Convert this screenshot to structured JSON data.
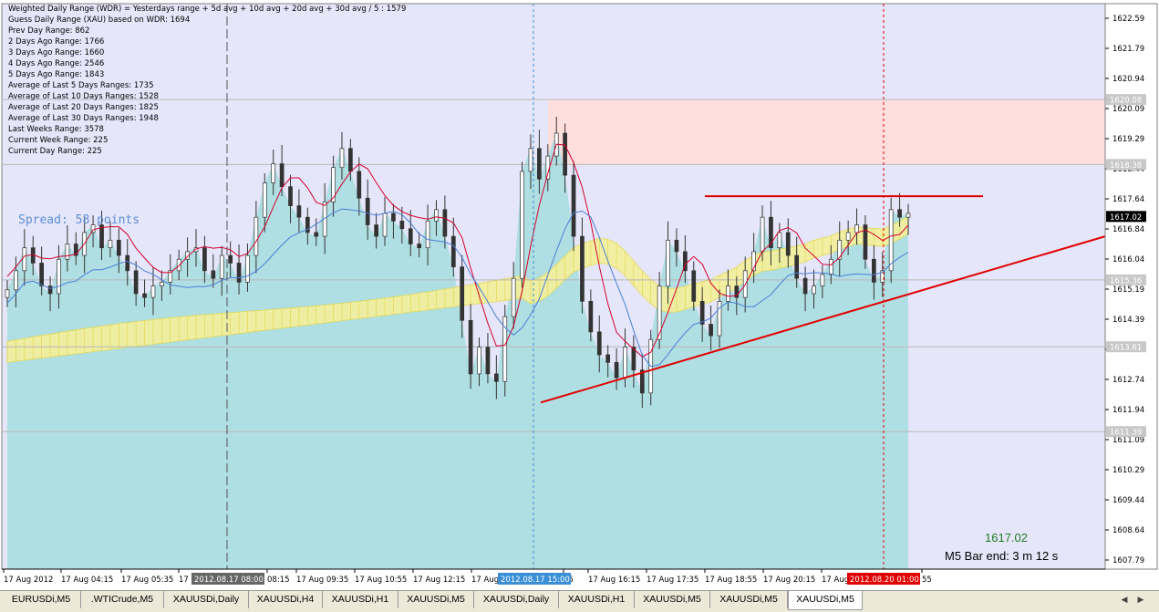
{
  "window": {
    "accent_bg": "#e6e6fa",
    "area_fill": "#b0dfe3"
  },
  "info_lines": [
    "Weighted Daily Range (WDR) = Yesterdays range + 5d avg + 10d avg + 20d avg + 30d avg / 5 : 1579",
    "Guess Daily Range (XAU) based on WDR: 1694",
    "Prev Day Range: 862",
    "2 Days Ago Range: 1766",
    "3 Days Ago Range: 1660",
    "4 Days Ago Range: 2546",
    "5 Days Ago Range: 1843",
    "Average of Last 5 Days Ranges: 1735",
    "Average of Last 10 Days Ranges: 1528",
    "Average of Last 20 Days Ranges: 1825",
    "Average of Last 30 Days Ranges: 1948",
    "Last Weeks Range: 3578",
    "Current Week Range: 225",
    "Current Day Range: 225"
  ],
  "spread_text": "Spread: 58 points",
  "current_price_text": "1617.02",
  "bar_end_text": "M5 Bar end: 3 m 12 s",
  "chart_data": {
    "type": "candlestick",
    "symbol": "XAUUSDi",
    "timeframe": "M5",
    "ylim": [
      1607.79,
      1622.59
    ],
    "y_ticks": [
      "1622.59",
      "1621.79",
      "1620.94",
      "1620.09",
      "1619.29",
      "1618.44",
      "1617.64",
      "1616.84",
      "1616.04",
      "1615.19",
      "1614.39",
      "1613.54",
      "1612.74",
      "1611.94",
      "1611.09",
      "1610.29",
      "1609.44",
      "1608.64",
      "1607.79"
    ],
    "x_tick_labels": [
      "17 Aug 2012",
      "17 Aug 04:15",
      "17 Aug 05:35",
      "17",
      "08:15",
      "17 Aug 09:35",
      "17 Aug 10:55",
      "17 Aug 12:15",
      "17 Aug",
      "55",
      "17 Aug 16:15",
      "17 Aug 17:35",
      "17 Aug 18:55",
      "17 Aug 20:15",
      "17 Aug",
      "55"
    ],
    "x_highlight_labels": [
      {
        "text": "2012.08.17 08:00",
        "color": "#666666"
      },
      {
        "text": "2012.08.17 15:00",
        "color": "#3a8fd6"
      },
      {
        "text": "2012.08.20 01:00",
        "color": "#e00000"
      }
    ],
    "price_level_labels": [
      {
        "price": 1620.08,
        "text": "1620.08"
      },
      {
        "price": 1618.38,
        "text": "1618.38"
      },
      {
        "price": 1617.02,
        "text": "1617.02",
        "current": true
      },
      {
        "price": 1615.36,
        "text": "1615.36"
      },
      {
        "price": 1613.61,
        "text": "1613.61"
      },
      {
        "price": 1611.39,
        "text": "1611.39"
      }
    ],
    "current_price": 1617.02,
    "zone": {
      "from_price": 1618.38,
      "to_price": 1620.08,
      "color": "#ffdede"
    },
    "resistance_line_price": 1617.55,
    "trendline": {
      "start_price": 1612.15,
      "end_price": 1616.5
    },
    "close_series": [
      1615.1,
      1615.6,
      1616.2,
      1615.8,
      1615.2,
      1615.0,
      1615.9,
      1616.3,
      1616.0,
      1616.6,
      1616.8,
      1616.2,
      1616.4,
      1616.0,
      1615.6,
      1615.0,
      1614.9,
      1615.2,
      1615.3,
      1615.6,
      1615.9,
      1616.1,
      1616.2,
      1615.6,
      1615.4,
      1616.0,
      1615.8,
      1615.3,
      1616.0,
      1617.0,
      1617.9,
      1618.4,
      1617.8,
      1617.3,
      1617.0,
      1616.6,
      1616.5,
      1617.4,
      1618.3,
      1618.8,
      1618.2,
      1617.5,
      1616.8,
      1616.5,
      1617.1,
      1616.9,
      1616.7,
      1616.3,
      1616.2,
      1616.9,
      1617.2,
      1616.5,
      1615.7,
      1614.3,
      1612.9,
      1613.6,
      1612.9,
      1612.7,
      1614.4,
      1615.4,
      1618.2,
      1618.8,
      1618.0,
      1618.6,
      1619.2,
      1618.1,
      1616.5,
      1614.8,
      1614.0,
      1613.4,
      1613.2,
      1612.8,
      1613.6,
      1613.0,
      1612.4,
      1613.8,
      1615.2,
      1616.4,
      1616.1,
      1615.6,
      1614.8,
      1614.2,
      1613.9,
      1614.8,
      1615.2,
      1614.9,
      1615.6,
      1616.1,
      1617.0,
      1616.2,
      1616.6,
      1616.0,
      1615.4,
      1615.0,
      1615.2,
      1615.5,
      1615.9,
      1616.4,
      1616.6,
      1616.8,
      1615.9,
      1615.3,
      1615.6,
      1617.2,
      1617.0,
      1617.1
    ]
  },
  "tabs": [
    "EURUSDi,M5",
    ".WTICrude,M5",
    "XAUUSDi,Daily",
    "XAUUSDi,H4",
    "XAUUSDi,H1",
    "XAUUSDi,M5",
    "XAUUSDi,Daily",
    "XAUUSDi,H1",
    "XAUUSDi,M5",
    "XAUUSDi,M5",
    "XAUUSDi,M5"
  ],
  "active_tab_index": 10
}
